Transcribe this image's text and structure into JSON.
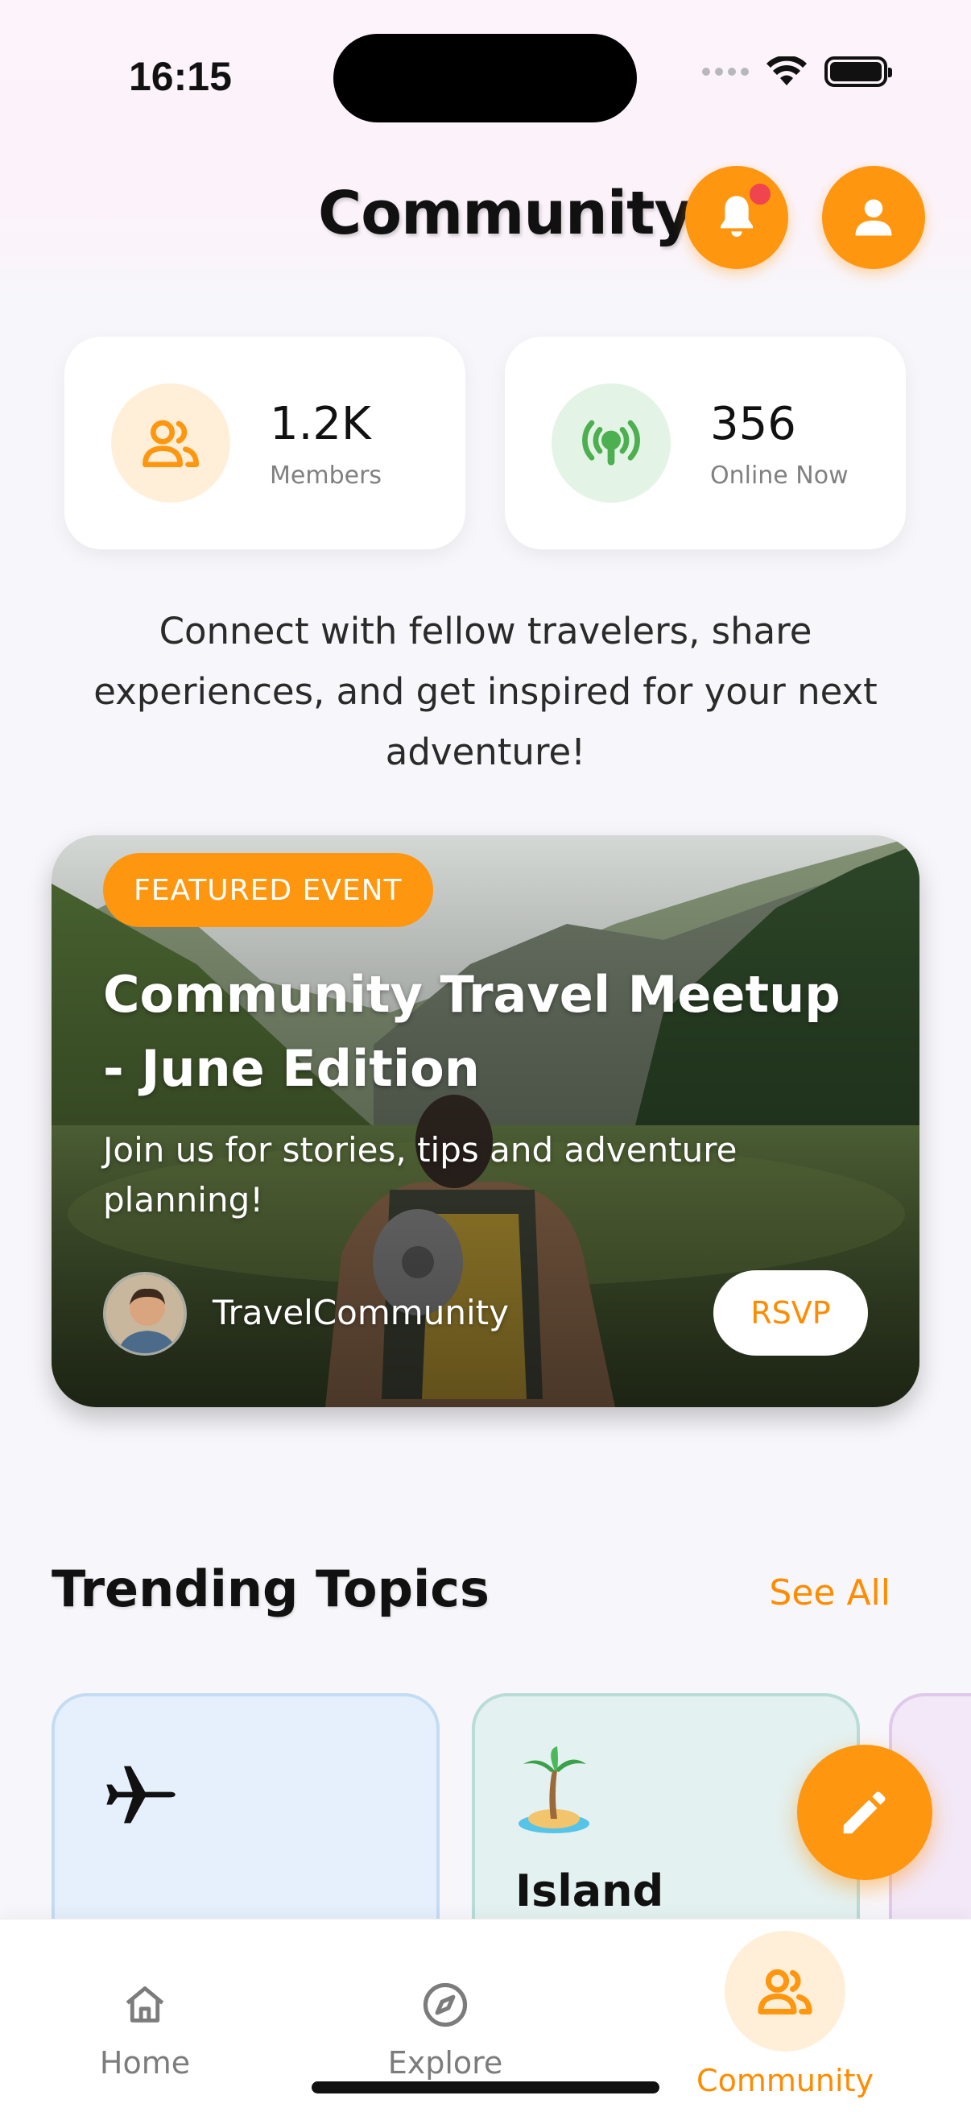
{
  "status_bar": {
    "time": "16:15"
  },
  "header": {
    "title": "Community"
  },
  "stats": [
    {
      "value": "1.2K",
      "label": "Members",
      "icon": "members-icon"
    },
    {
      "value": "356",
      "label": "Online Now",
      "icon": "broadcast-icon"
    }
  ],
  "intro": "Connect with fellow travelers, share experiences, and get inspired for your next adventure!",
  "featured": {
    "badge": "FEATURED EVENT",
    "title": "Community Travel Meetup - June Edition",
    "description": "Join us for stories, tips and adventure planning!",
    "author": "TravelCommunity",
    "rsvp_label": "RSVP"
  },
  "trending": {
    "title": "Trending Topics",
    "see_all": "See All",
    "topics": [
      {
        "emoji": "✈",
        "label": ""
      },
      {
        "emoji": "🏝",
        "label": "Island"
      }
    ]
  },
  "nav": {
    "items": [
      {
        "label": "Home"
      },
      {
        "label": "Explore"
      },
      {
        "label": "Community"
      }
    ]
  },
  "colors": {
    "accent": "#ff960f",
    "accent_text": "#ff8c00",
    "online_green": "#4caf50"
  }
}
